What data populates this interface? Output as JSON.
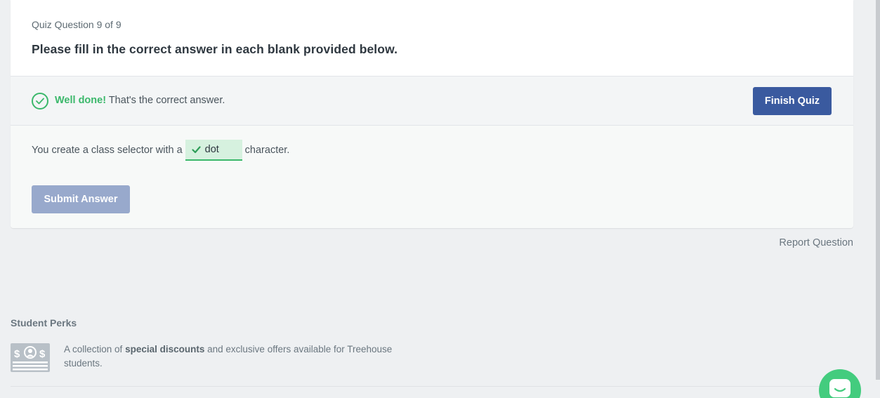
{
  "quiz": {
    "counter": "Quiz Question 9 of 9",
    "prompt": "Please fill in the correct answer in each blank provided below."
  },
  "feedback": {
    "icon": "check-circle-icon",
    "strong": "Well done!",
    "message": "That's the correct answer.",
    "finish_label": "Finish Quiz"
  },
  "answer": {
    "before": "You create a class selector with a",
    "blank_value": "dot",
    "after": "character.",
    "submit_label": "Submit Answer"
  },
  "report_label": "Report Question",
  "perks": {
    "title": "Student Perks",
    "icon": "discount-card-icon",
    "text_before": "A collection of",
    "text_bold": "special discounts",
    "text_after": "and exclusive offers available for Treehouse students."
  },
  "colors": {
    "success": "#3bb86b",
    "primary_button": "#3a5a9f",
    "disabled_button": "#98a9cc",
    "chat": "#43cc7e"
  }
}
